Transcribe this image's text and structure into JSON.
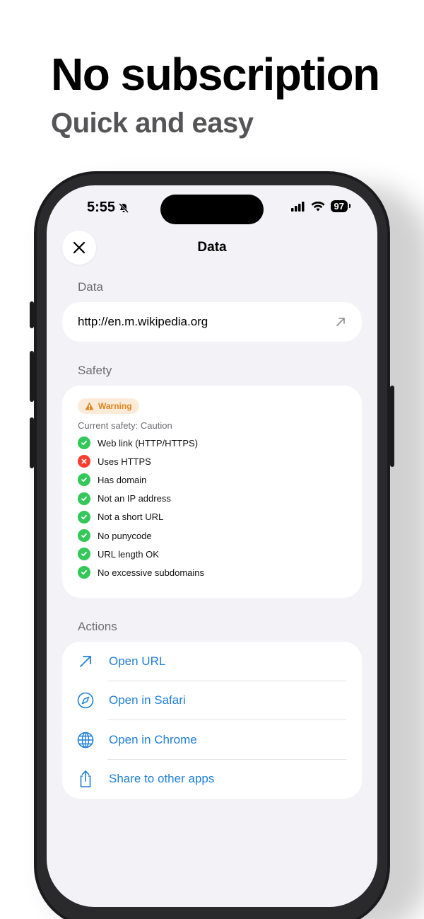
{
  "promo": {
    "headline": "No subscription",
    "subhead": "Quick and easy"
  },
  "status_bar": {
    "time": "5:55",
    "battery": "97",
    "icons": [
      "bell-slash-icon",
      "signal-icon",
      "wifi-icon",
      "battery-icon"
    ]
  },
  "nav": {
    "title": "Data",
    "close_icon": "close-icon"
  },
  "data_section": {
    "label": "Data",
    "url": "http://en.m.wikipedia.org",
    "open_icon": "arrow-up-right-icon"
  },
  "safety_section": {
    "label": "Safety",
    "badge": "Warning",
    "current": "Current safety: Caution",
    "checks": [
      {
        "label": "Web link (HTTP/HTTPS)",
        "status": "pass"
      },
      {
        "label": "Uses HTTPS",
        "status": "fail"
      },
      {
        "label": "Has domain",
        "status": "pass"
      },
      {
        "label": "Not an IP address",
        "status": "pass"
      },
      {
        "label": "Not a short URL",
        "status": "pass"
      },
      {
        "label": "No punycode",
        "status": "pass"
      },
      {
        "label": "URL length OK",
        "status": "pass"
      },
      {
        "label": "No excessive subdomains",
        "status": "pass"
      }
    ]
  },
  "actions_section": {
    "label": "Actions",
    "items": [
      {
        "label": "Open URL",
        "icon": "arrow-up-right-icon"
      },
      {
        "label": "Open in Safari",
        "icon": "compass-icon"
      },
      {
        "label": "Open in Chrome",
        "icon": "globe-icon"
      },
      {
        "label": "Share to other apps",
        "icon": "share-icon"
      }
    ]
  },
  "colors": {
    "accent": "#1f7fd6",
    "pass": "#34c759",
    "fail": "#ff3b30",
    "warning": "#e08522",
    "warning_bg": "#fdebd9"
  }
}
